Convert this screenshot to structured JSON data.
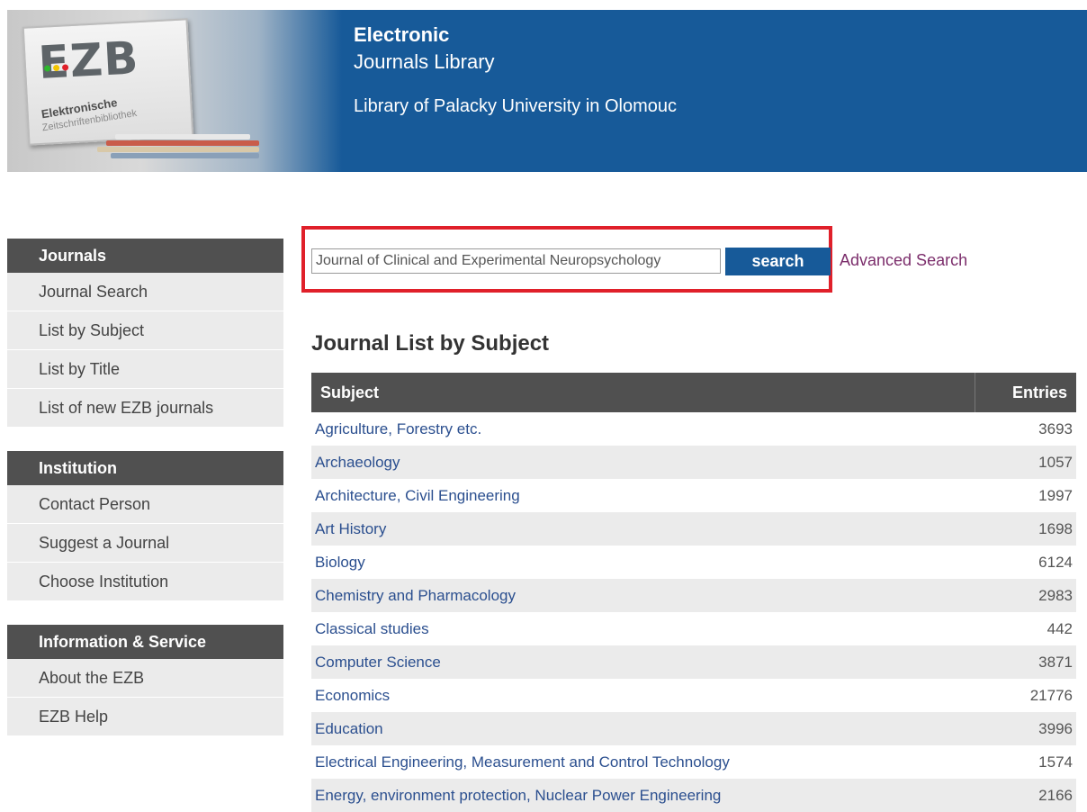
{
  "header": {
    "logo_mark": "EZB",
    "logo_sub1": "Elektronische",
    "logo_sub2": "Zeitschriftenbibliothek",
    "title_line1": "Electronic",
    "title_line2": "Journals Library",
    "institution": "Library of Palacky University in Olomouc",
    "bg_color": "#175a99"
  },
  "sidebar": {
    "sections": [
      {
        "title": "Journals",
        "items": [
          "Journal Search",
          "List by Subject",
          "List by Title",
          "List of new EZB journals"
        ]
      },
      {
        "title": "Institution",
        "items": [
          "Contact Person",
          "Suggest a Journal",
          "Choose Institution"
        ]
      },
      {
        "title": "Information & Service",
        "items": [
          "About the EZB",
          "EZB Help"
        ]
      }
    ]
  },
  "search": {
    "value": "Journal of Clinical and Experimental Neuropsychology",
    "button_label": "search",
    "advanced_label": "Advanced Search",
    "highlight_color": "#e0202a"
  },
  "list": {
    "title": "Journal List by Subject",
    "columns": [
      "Subject",
      "Entries"
    ],
    "rows": [
      {
        "subject": "Agriculture, Forestry etc.",
        "entries": "3693"
      },
      {
        "subject": "Archaeology",
        "entries": "1057"
      },
      {
        "subject": "Architecture, Civil Engineering",
        "entries": "1997"
      },
      {
        "subject": "Art History",
        "entries": "1698"
      },
      {
        "subject": "Biology",
        "entries": "6124"
      },
      {
        "subject": "Chemistry and Pharmacology",
        "entries": "2983"
      },
      {
        "subject": "Classical studies",
        "entries": "442"
      },
      {
        "subject": "Computer Science",
        "entries": "3871"
      },
      {
        "subject": "Economics",
        "entries": "21776"
      },
      {
        "subject": "Education",
        "entries": "3996"
      },
      {
        "subject": "Electrical Engineering, Measurement and Control Technology",
        "entries": "1574"
      },
      {
        "subject": "Energy, environment protection, Nuclear Power Engineering",
        "entries": "2166"
      }
    ]
  }
}
